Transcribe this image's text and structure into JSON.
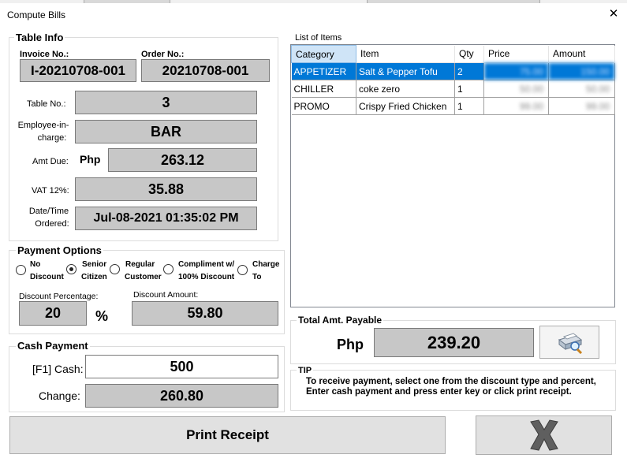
{
  "window": {
    "title": "Compute Bills"
  },
  "table_info": {
    "legend": "Table Info",
    "invoice_label": "Invoice No.:",
    "invoice_value": "I-20210708-001",
    "order_label": "Order No.:",
    "order_value": "20210708-001",
    "table_label": "Table No.:",
    "table_value": "3",
    "employee_label_1": "Employee-in-",
    "employee_label_2": "charge:",
    "employee_value": "BAR",
    "amt_due_label": "Amt Due:",
    "amt_due_currency": "Php",
    "amt_due_value": "263.12",
    "vat_label": "VAT 12%:",
    "vat_value": "35.88",
    "datetime_label_1": "Date/Time",
    "datetime_label_2": "Ordered:",
    "datetime_value": "Jul-08-2021  01:35:02 PM"
  },
  "payment_options": {
    "legend": "Payment Options",
    "options": [
      {
        "line1": "No",
        "line2": "Discount",
        "selected": false
      },
      {
        "line1": "Senior",
        "line2": "Citizen",
        "selected": true
      },
      {
        "line1": "Regular",
        "line2": "Customer",
        "selected": false
      },
      {
        "line1": "Compliment w/",
        "line2": "100% Discount",
        "selected": false
      },
      {
        "line1": "Charge",
        "line2": "To",
        "selected": false
      }
    ],
    "discount_pct_label": "Discount Percentage:",
    "discount_pct_value": "20",
    "pct_symbol": "%",
    "discount_amt_label": "Discount Amount:",
    "discount_amt_value": "59.80"
  },
  "cash_payment": {
    "legend": "Cash Payment",
    "cash_label": "[F1] Cash:",
    "cash_value": "500",
    "change_label": "Change:",
    "change_value": "260.80"
  },
  "items": {
    "legend": "List of Items",
    "columns": [
      "Category",
      "Item",
      "Qty",
      "Price",
      "Amount"
    ],
    "rows": [
      {
        "category": "APPETIZER",
        "item": "Salt & Pepper Tofu",
        "qty": "2",
        "price": "75.00",
        "amount": "150.00"
      },
      {
        "category": "CHILLER",
        "item": "coke zero",
        "qty": "1",
        "price": "50.00",
        "amount": "50.00"
      },
      {
        "category": "PROMO",
        "item": "Crispy Fried Chicken",
        "qty": "1",
        "price": "99.00",
        "amount": "99.00"
      }
    ]
  },
  "total": {
    "legend": "Total Amt. Payable",
    "currency": "Php",
    "value": "239.20",
    "print_icon": "printer-magnifier-icon"
  },
  "tip": {
    "legend": "TIP",
    "text": "To receive payment, select one from the discount type and percent, Enter cash payment and press enter key or click print receipt."
  },
  "actions": {
    "print_label": "Print Receipt",
    "cancel_icon": "x-cancel-icon"
  },
  "colors": {
    "selection": "#0078d7",
    "readonly_box": "#c7c7c7"
  }
}
